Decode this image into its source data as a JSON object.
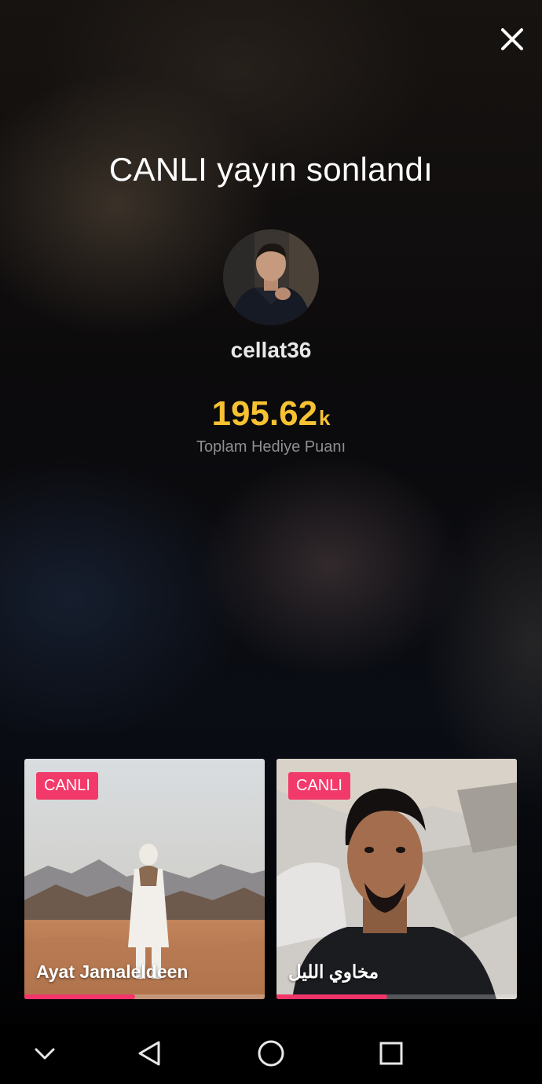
{
  "header": {
    "title": "CANLI yayın sonlandı",
    "close_icon": "close-icon"
  },
  "host": {
    "username": "cellat36",
    "avatar_icon": "avatar"
  },
  "stats": {
    "gift_points_value": "195.62",
    "gift_points_unit": "k",
    "gift_points_label": "Toplam Hediye Puanı"
  },
  "recommended": [
    {
      "badge": "CANLI",
      "name": "Ayat Jamaleldeen",
      "progress": 0.46
    },
    {
      "badge": "CANLI",
      "name": "مخاوي الليل",
      "progress": 0.46
    }
  ],
  "navbar": {
    "icons": [
      "chevron-down-icon",
      "back-triangle-icon",
      "home-circle-icon",
      "recents-square-icon"
    ]
  },
  "colors": {
    "accent_pink": "#f23a6a",
    "gift_gold": "#f6c232",
    "label_gray": "#8e8e8e"
  }
}
